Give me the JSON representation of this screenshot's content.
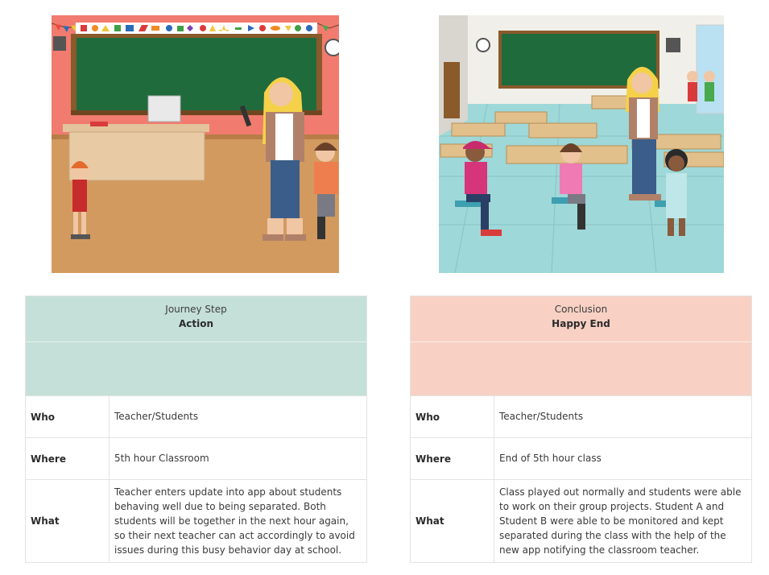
{
  "colors": {
    "action_header": "#c5e0d8",
    "conclusion_header": "#f8d1c4",
    "grid_border": "#e3e3e3"
  },
  "scenes": [
    {
      "name": "teacher-entering-update-scene"
    },
    {
      "name": "classroom-happy-end-scene"
    }
  ],
  "cards": [
    {
      "step": "Journey Step",
      "title": "Action",
      "rows": {
        "who_label": "Who",
        "who_value": "Teacher/Students",
        "where_label": "Where",
        "where_value": "5th hour Classroom",
        "what_label": "What",
        "what_value": "Teacher enters update into app about students behaving well due to being separated. Both students will be together in the next hour again, so their next teacher can act accordingly to avoid issues during this busy behavior day at school."
      }
    },
    {
      "step": "Conclusion",
      "title": "Happy End",
      "rows": {
        "who_label": "Who",
        "who_value": "Teacher/Students",
        "where_label": "Where",
        "where_value": "End of 5th hour class",
        "what_label": "What",
        "what_value": "Class played out normally and students were able to work on their group projects. Student A and Student B were able to be monitored and kept separated during the class with the help of the new app notifying the classroom teacher."
      }
    }
  ]
}
